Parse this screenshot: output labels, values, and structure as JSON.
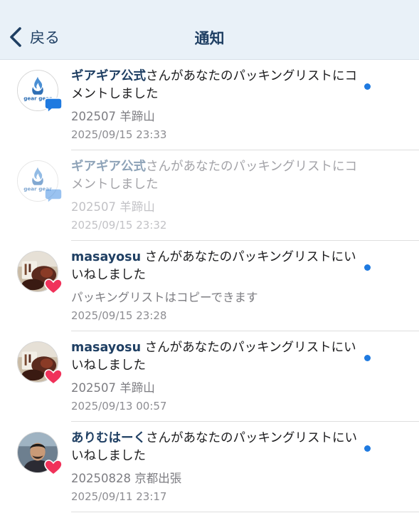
{
  "nav": {
    "back_label": "戻る",
    "title": "通知"
  },
  "notifications": [
    {
      "user": "ギアギア公式",
      "message": "さんがあなたのパッキングリストにコメントしました",
      "subtitle": "202507 羊蹄山",
      "timestamp": "2025/09/15 23:33",
      "unread": true,
      "type": "comment",
      "avatar": "gear-gear-logo"
    },
    {
      "user": "ギアギア公式",
      "message": "さんがあなたのパッキングリストにコメントしました",
      "subtitle": "202507 羊蹄山",
      "timestamp": "2025/09/15 23:32",
      "unread": false,
      "type": "comment",
      "avatar": "gear-gear-logo"
    },
    {
      "user": "masayosu",
      "message": " さんがあなたのパッキングリストにいいねしました",
      "subtitle": "パッキングリストはコピーできます",
      "timestamp": "2025/09/15 23:28",
      "unread": true,
      "type": "like",
      "avatar": "food-photo"
    },
    {
      "user": "masayosu",
      "message": " さんがあなたのパッキングリストにいいねしました",
      "subtitle": "202507 羊蹄山",
      "timestamp": "2025/09/13 00:57",
      "unread": true,
      "type": "like",
      "avatar": "food-photo"
    },
    {
      "user": "ありむはーく",
      "message": "さんがあなたのパッキングリストにいいねしました",
      "subtitle": "20250828 京都出張",
      "timestamp": "2025/09/11 23:17",
      "unread": true,
      "type": "like",
      "avatar": "person-photo"
    }
  ],
  "colors": {
    "accent": "#1f3f63",
    "unread_dot": "#1f7ae0",
    "like_badge": "#f0325a",
    "comment_badge": "#1f7ae0",
    "nav_bg": "#e9f1f8"
  },
  "icons": {
    "back": "chevron-left-icon",
    "comment": "speech-bubble-icon",
    "like": "heart-icon"
  }
}
